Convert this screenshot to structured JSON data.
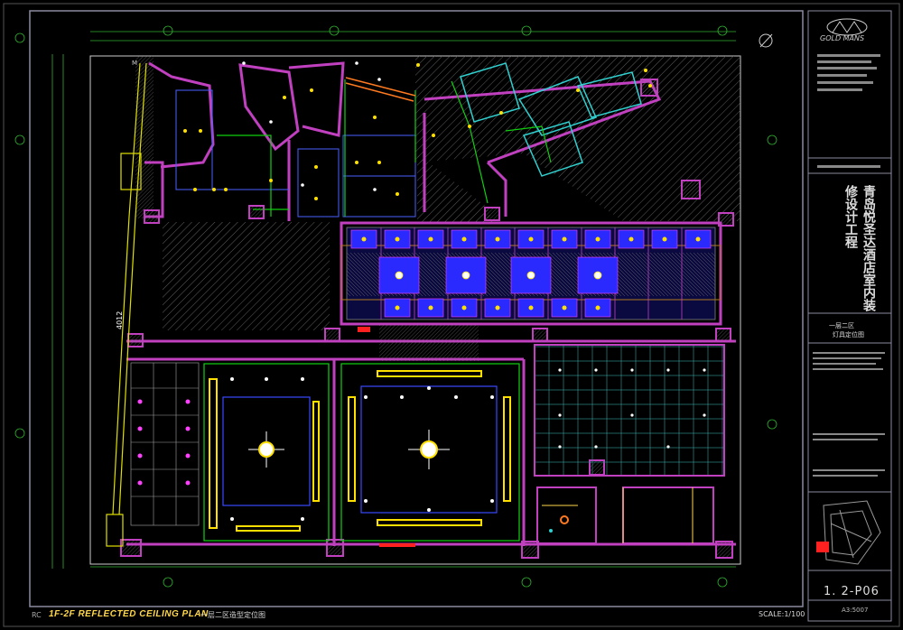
{
  "drawing": {
    "sheet_label": "RC",
    "title_en": "1F-2F REFLECTED CEILING PLAN",
    "title_cn": "一层二区造型定位图",
    "scale": "SCALE:1/100",
    "sheet_number": "1. 2-P06",
    "paper": "A3:5007"
  },
  "title_block": {
    "logo_text": "GOLD MANS",
    "project_name": "青岛悦圣达酒店室内装修设计工程",
    "drawing_name_line1": "一层二区",
    "drawing_name_line2": "灯具定位图"
  },
  "colors": {
    "background": "#000000",
    "wall": "#c040c0",
    "wall_fill": "#7a2a7a",
    "frame": "#8a8aa0",
    "ceiling_panel": "#3a4aff",
    "light_yellow": "#ffe000",
    "green": "#10e010",
    "cyan": "#30d0d0",
    "hatch": "#6a6a6a",
    "grid_cyan": "#00b0b0",
    "red": "#ff2020",
    "orange": "#ff7a20"
  }
}
